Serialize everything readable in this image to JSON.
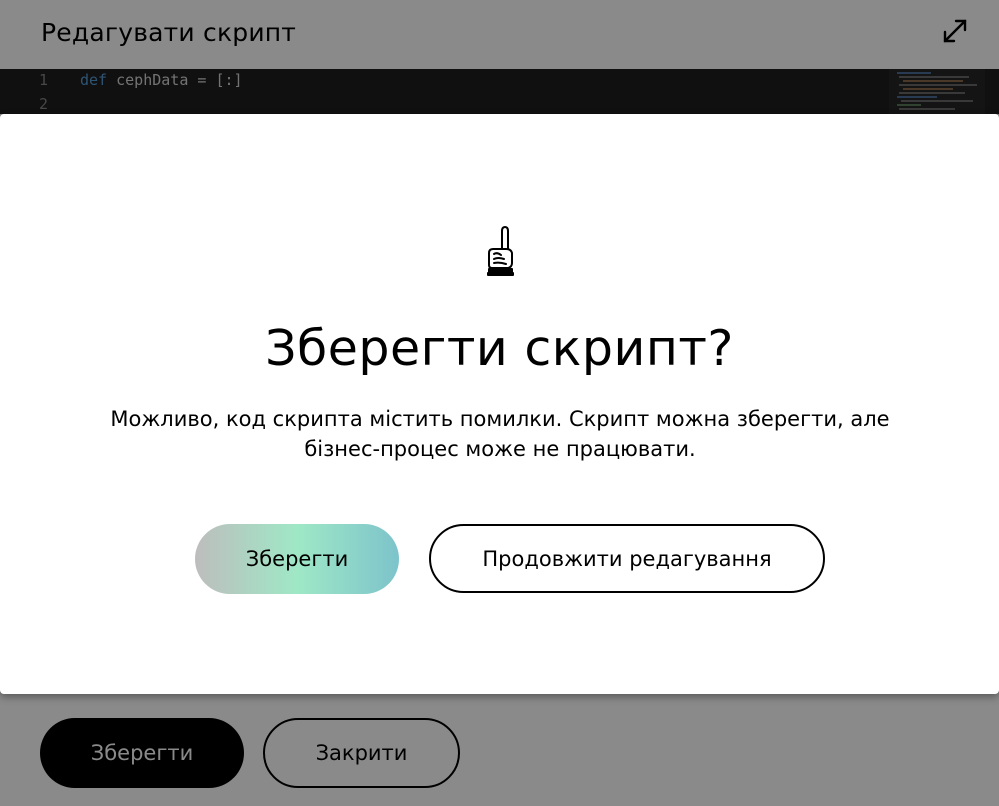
{
  "editor": {
    "title": "Редагувати скрипт",
    "lines": [
      {
        "number": "1",
        "keyword": "def",
        "text": " cephData ",
        "operator": "=",
        "rest": " [:]"
      },
      {
        "number": "2",
        "keyword": "",
        "text": "",
        "operator": "",
        "rest": ""
      }
    ],
    "save_label": "Зберегти",
    "close_label": "Закрити"
  },
  "modal": {
    "icon": "pointing-finger-icon",
    "title": "Зберегти скрипт?",
    "message": "Можливо, код скрипта містить помилки. Скрипт можна зберегти, але бізнес-процес може не працювати.",
    "save_label": "Зберегти",
    "continue_label": "Продовжити редагування"
  },
  "colors": {
    "overlay": "rgba(0,0,0,0.46)",
    "editor_bg": "#1e1e1e",
    "keyword": "#569cd6",
    "gradient": [
      "#bdbdbd",
      "#9fe8c6",
      "#7dc3cb"
    ]
  }
}
